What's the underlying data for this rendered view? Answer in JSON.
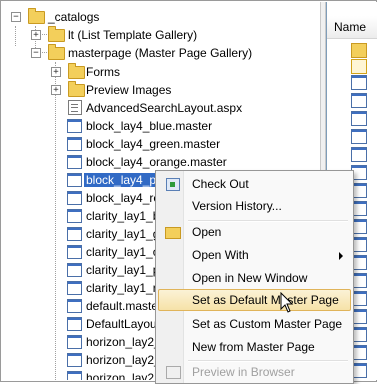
{
  "tree": {
    "root": {
      "label": "_catalogs"
    },
    "lt": {
      "label": "lt (List Template Gallery)"
    },
    "masterpage": {
      "label": "masterpage (Master Page Gallery)"
    },
    "children": [
      {
        "label": "Forms",
        "icon": "folder-icon"
      },
      {
        "label": "Preview Images",
        "icon": "folder-icon"
      },
      {
        "label": "AdvancedSearchLayout.aspx",
        "icon": "aspx-page-icon"
      },
      {
        "label": "block_lay4_blue.master",
        "icon": "master-page-icon"
      },
      {
        "label": "block_lay4_green.master",
        "icon": "master-page-icon"
      },
      {
        "label": "block_lay4_orange.master",
        "icon": "master-page-icon"
      },
      {
        "label": "block_lay4_pur",
        "icon": "master-page-icon",
        "selected": true
      },
      {
        "label": "block_lay4_red",
        "icon": "master-page-icon"
      },
      {
        "label": "clarity_lay1_blu",
        "icon": "master-page-icon"
      },
      {
        "label": "clarity_lay1_gr",
        "icon": "master-page-icon"
      },
      {
        "label": "clarity_lay1_or",
        "icon": "master-page-icon"
      },
      {
        "label": "clarity_lay1_pu",
        "icon": "master-page-icon"
      },
      {
        "label": "clarity_lay1_re",
        "icon": "master-page-icon"
      },
      {
        "label": "default.master",
        "icon": "master-page-icon"
      },
      {
        "label": "DefaultLayout.",
        "icon": "master-page-icon"
      },
      {
        "label": "horizon_lay2_b",
        "icon": "master-page-icon"
      },
      {
        "label": "horizon_lay2_g",
        "icon": "master-page-icon"
      },
      {
        "label": "horizon_lay2_o",
        "icon": "master-page-icon"
      }
    ]
  },
  "right_pane": {
    "column_header": "Name"
  },
  "context_menu": {
    "items": [
      {
        "label": "Check Out",
        "icon": "check-out-icon"
      },
      {
        "label": "Version History...",
        "icon": ""
      },
      {
        "label": "Open",
        "icon": "open-folder-icon"
      },
      {
        "label": "Open With",
        "icon": "",
        "submenu": true
      },
      {
        "label": "Open in New Window",
        "icon": ""
      },
      {
        "label": "Set as Default Master Page",
        "icon": "",
        "highlighted": true
      },
      {
        "label": "Set as Custom Master Page",
        "icon": ""
      },
      {
        "label": "New from Master Page",
        "icon": ""
      },
      {
        "label": "Preview in Browser",
        "icon": "preview-icon",
        "disabled": true
      }
    ]
  },
  "colors": {
    "selection": "#316ac5",
    "menu_highlight": "#f6e2a8",
    "folder": "#f3cf5b"
  }
}
